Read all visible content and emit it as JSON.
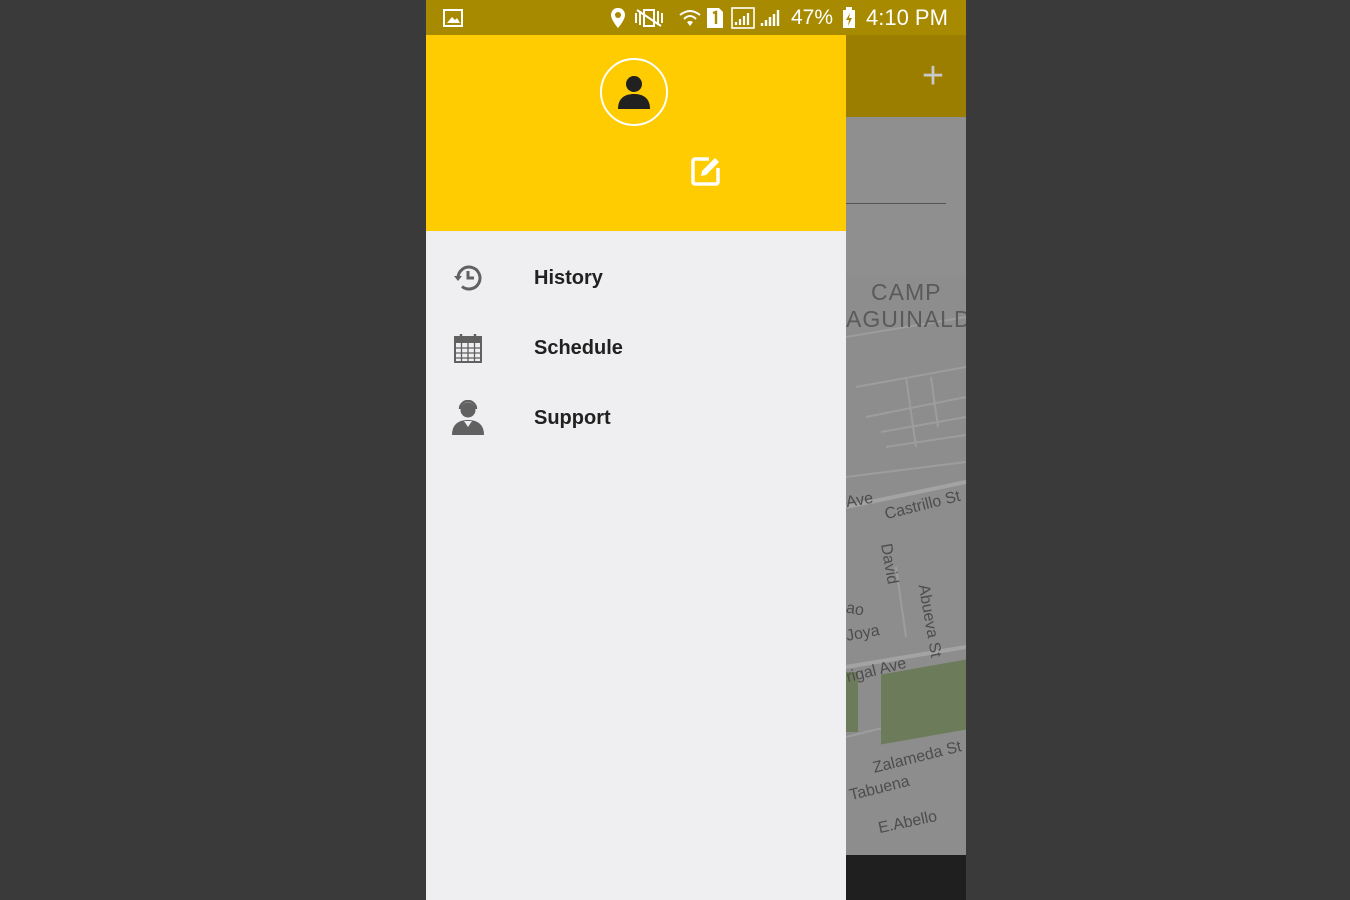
{
  "status_bar": {
    "battery": "47%",
    "time": "4:10 PM",
    "icons": [
      "image-icon",
      "location-pin-icon",
      "vibrate-mute-icon",
      "wifi-icon",
      "sim-1-icon",
      "signal-icon",
      "signal-icon",
      "battery-charging-icon"
    ]
  },
  "drawer": {
    "header_color": "#fecc00",
    "avatar_icon": "person-icon",
    "edit_icon": "edit-icon",
    "items": [
      {
        "label": "History",
        "icon": "history-icon"
      },
      {
        "label": "Schedule",
        "icon": "calendar-icon"
      },
      {
        "label": "Support",
        "icon": "support-agent-icon"
      }
    ]
  },
  "background_app": {
    "toolbar_action_icon": "plus-icon",
    "map_labels": {
      "camp": "CAMP",
      "aguinaldo": "AGUINALDO",
      "ave": "Ave",
      "castrillo": "Castrillo St",
      "david": "David",
      "ao": "ao",
      "joya": "Joya",
      "abueva": "Abueva St",
      "rigal": "rigal Ave",
      "zalameda": "Zalameda St",
      "tabuena": "Tabuena",
      "abello": "E.Abello"
    }
  }
}
